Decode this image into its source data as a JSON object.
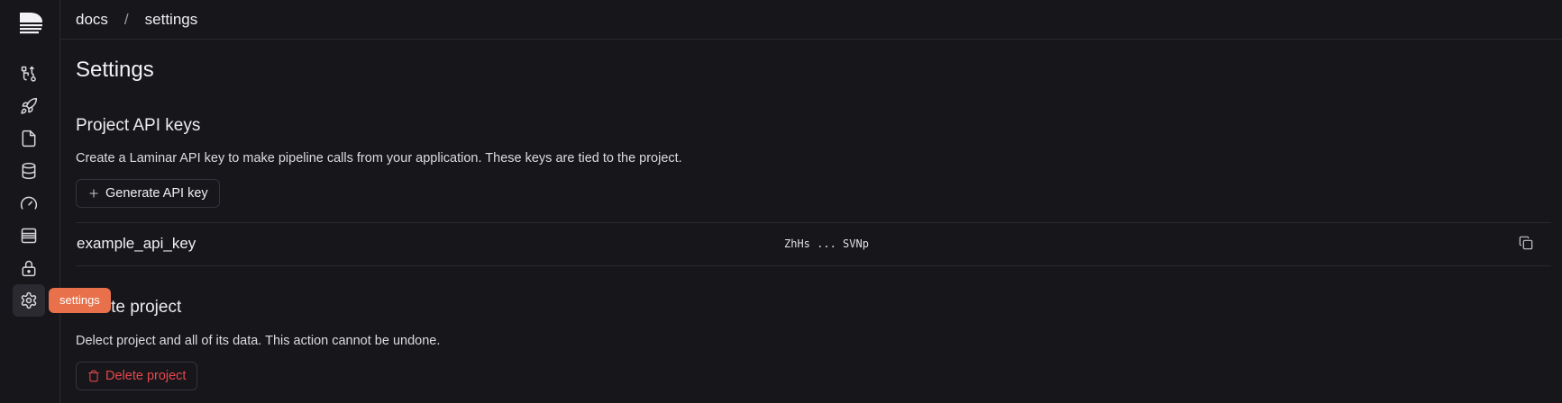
{
  "breadcrumb": {
    "project": "docs",
    "separator": "/",
    "page": "settings"
  },
  "sidebar": {
    "items": [
      {
        "icon": "pipeline-icon"
      },
      {
        "icon": "rocket-icon"
      },
      {
        "icon": "file-icon"
      },
      {
        "icon": "database-icon"
      },
      {
        "icon": "gauge-icon"
      },
      {
        "icon": "table-icon"
      },
      {
        "icon": "lock-icon"
      },
      {
        "icon": "gear-icon",
        "active": true
      }
    ],
    "tooltip": "settings"
  },
  "page": {
    "title": "Settings"
  },
  "api_keys": {
    "title": "Project API keys",
    "description": "Create a Laminar API key to make pipeline calls from your application. These keys are tied to the project.",
    "generate_label": "Generate API key",
    "keys": [
      {
        "name": "example_api_key",
        "value": "ZhHs ... SVNp"
      }
    ]
  },
  "delete_project": {
    "title": "Delete project",
    "description": "Delect project and all of its data. This action cannot be undone.",
    "button_label": "Delete project"
  },
  "colors": {
    "accent": "#e8704a",
    "danger": "#e5484d",
    "background": "#17161b"
  }
}
